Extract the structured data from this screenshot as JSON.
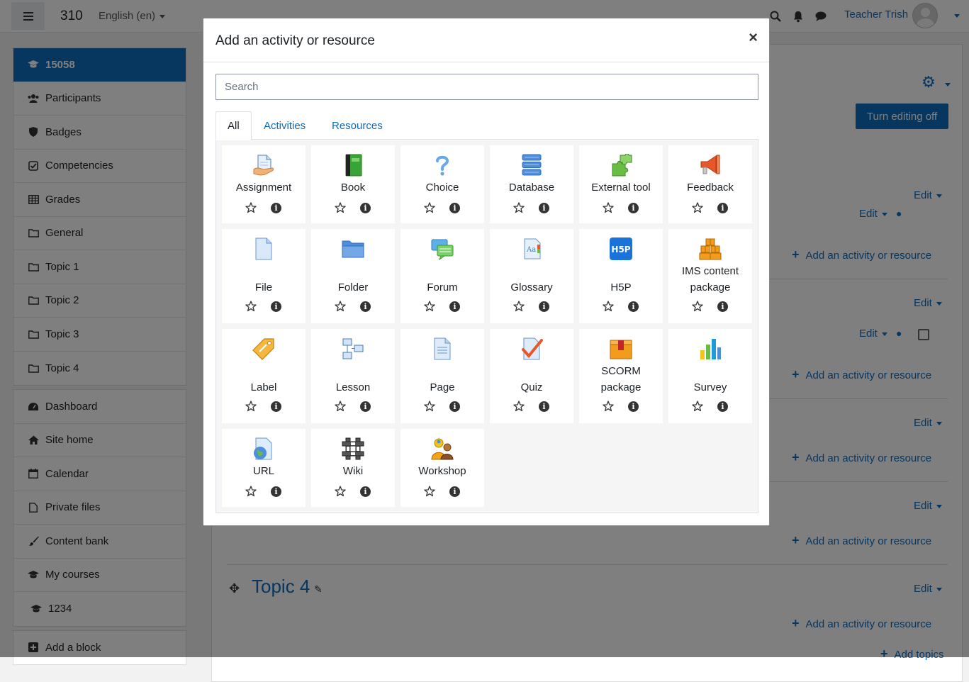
{
  "navbar": {
    "site_name": "310",
    "language": "English (en)",
    "user_name": "Teacher Trish"
  },
  "sidebar": {
    "course_group": [
      {
        "label": "15058",
        "icon": "graduation-cap-icon",
        "active": true
      },
      {
        "label": "Participants",
        "icon": "users-icon"
      },
      {
        "label": "Badges",
        "icon": "shield-icon"
      },
      {
        "label": "Competencies",
        "icon": "check-square-icon"
      },
      {
        "label": "Grades",
        "icon": "table-icon"
      },
      {
        "label": "General",
        "icon": "folder-icon"
      },
      {
        "label": "Topic 1",
        "icon": "folder-icon"
      },
      {
        "label": "Topic 2",
        "icon": "folder-icon"
      },
      {
        "label": "Topic 3",
        "icon": "folder-icon"
      },
      {
        "label": "Topic 4",
        "icon": "folder-icon"
      }
    ],
    "site_group": [
      {
        "label": "Dashboard",
        "icon": "dashboard-icon"
      },
      {
        "label": "Site home",
        "icon": "home-icon"
      },
      {
        "label": "Calendar",
        "icon": "calendar-icon"
      },
      {
        "label": "Private files",
        "icon": "file-icon"
      },
      {
        "label": "Content bank",
        "icon": "brush-icon"
      },
      {
        "label": "My courses",
        "icon": "graduation-cap-icon"
      },
      {
        "label": "1234",
        "icon": "graduation-cap-icon"
      }
    ],
    "add_block": "Add a block"
  },
  "main": {
    "turn_editing": "Turn editing off",
    "edit_label": "Edit",
    "add_activity": "Add an activity or resource",
    "topic4_title": "Topic 4",
    "add_topics": "Add topics"
  },
  "modal": {
    "title": "Add an activity or resource",
    "close": "×",
    "search_placeholder": "Search",
    "tabs": [
      "All",
      "Activities",
      "Resources"
    ],
    "items": [
      {
        "label": "Assignment",
        "icon": "assignment-icon"
      },
      {
        "label": "Book",
        "icon": "book-icon"
      },
      {
        "label": "Choice",
        "icon": "choice-icon"
      },
      {
        "label": "Database",
        "icon": "database-icon"
      },
      {
        "label": "External tool",
        "icon": "external-tool-icon"
      },
      {
        "label": "Feedback",
        "icon": "feedback-icon"
      },
      {
        "label": "File",
        "icon": "file-icon"
      },
      {
        "label": "Folder",
        "icon": "folder-icon"
      },
      {
        "label": "Forum",
        "icon": "forum-icon"
      },
      {
        "label": "Glossary",
        "icon": "glossary-icon"
      },
      {
        "label": "H5P",
        "icon": "h5p-icon"
      },
      {
        "label": "IMS content package",
        "icon": "ims-package-icon"
      },
      {
        "label": "Label",
        "icon": "label-icon"
      },
      {
        "label": "Lesson",
        "icon": "lesson-icon"
      },
      {
        "label": "Page",
        "icon": "page-icon"
      },
      {
        "label": "Quiz",
        "icon": "quiz-icon"
      },
      {
        "label": "SCORM package",
        "icon": "scorm-icon"
      },
      {
        "label": "Survey",
        "icon": "survey-icon"
      },
      {
        "label": "URL",
        "icon": "url-icon"
      },
      {
        "label": "Wiki",
        "icon": "wiki-icon"
      },
      {
        "label": "Workshop",
        "icon": "workshop-icon"
      }
    ]
  },
  "colors": {
    "brand": "#0f6cbf",
    "overlay": "#000000"
  }
}
